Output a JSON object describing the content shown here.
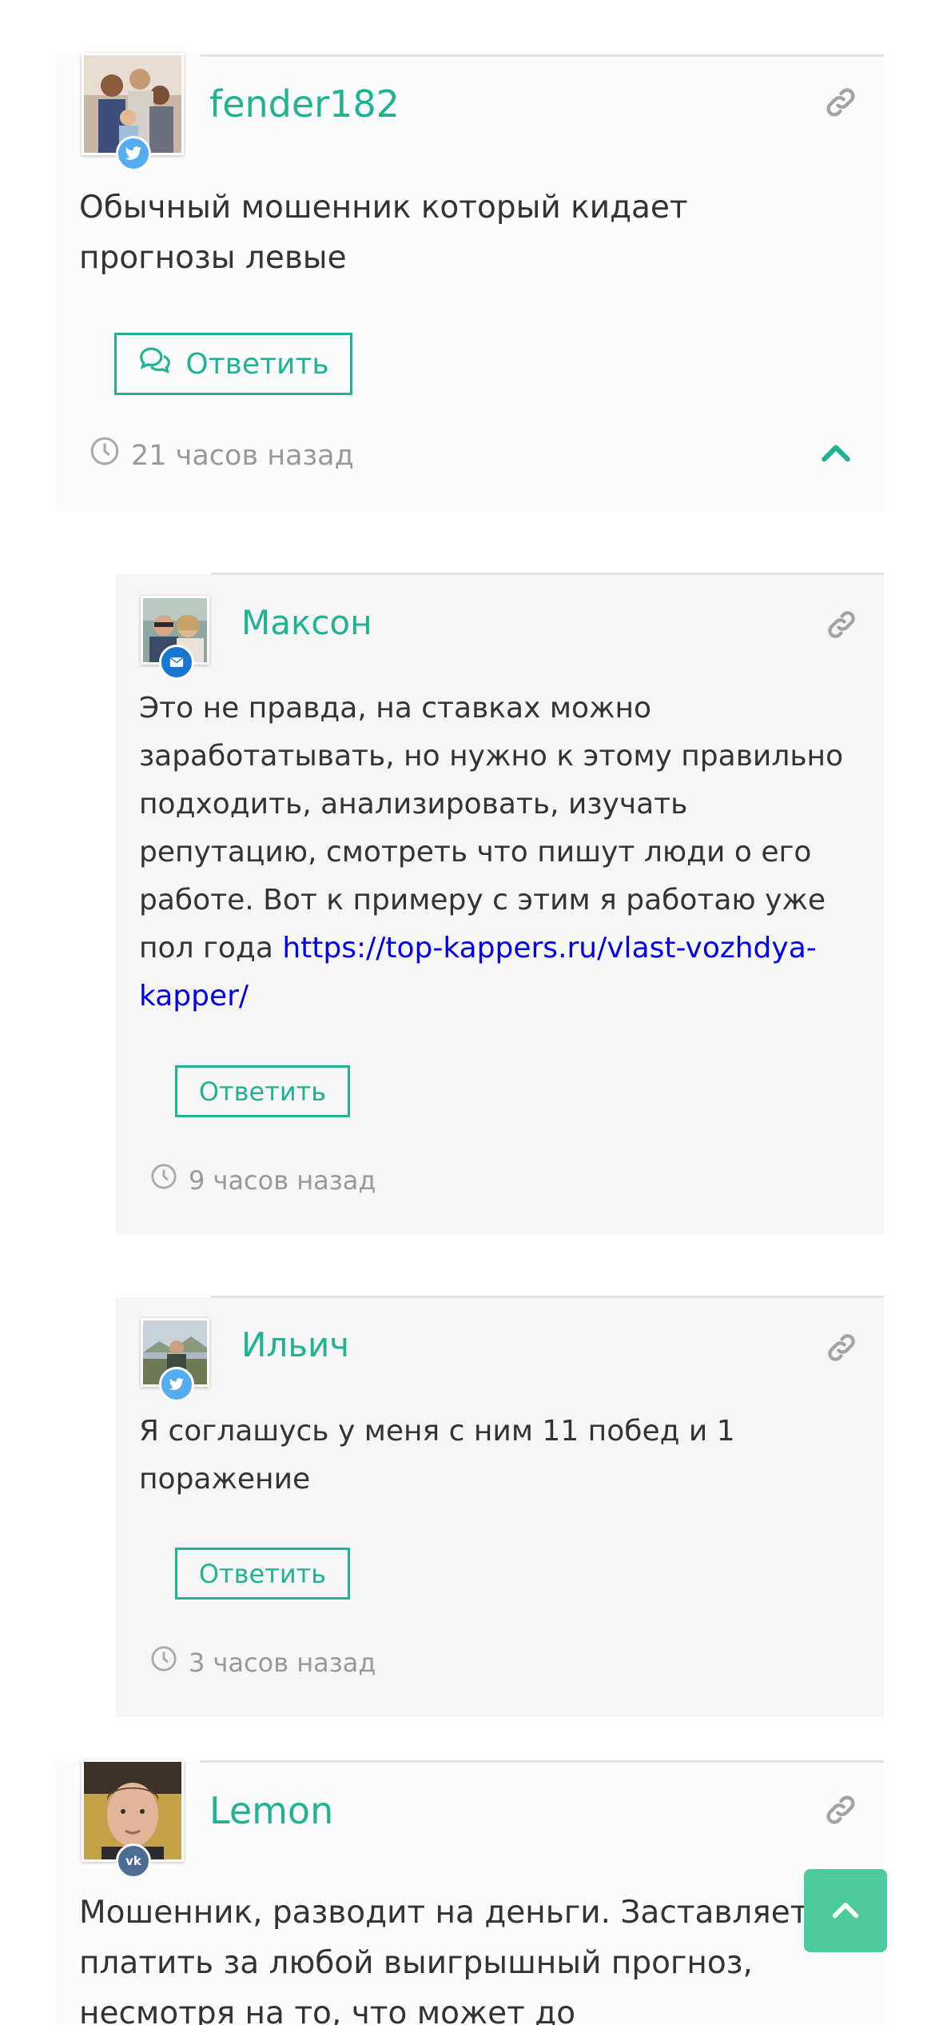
{
  "comments": [
    {
      "author": "fender182",
      "social": "twitter-icon",
      "text": "Обычный мошенник который кидает прогнозы левые",
      "reply_label": "Ответить",
      "time": "21 часов назад"
    },
    {
      "author": "Максон",
      "social": "email-icon",
      "text": "Это не правда, на ставках можно заработатывать, но нужно к этому правильно подходить, анализировать, изучать репутацию, смотреть что пишут люди о его работе. Вот к примеру с этим я работаю уже пол года ",
      "link": "https://top-kappers.ru/vlast-vozhdya-kapper/",
      "reply_label": "Ответить",
      "time": "9 часов назад"
    },
    {
      "author": "Ильич",
      "social": "twitter-icon",
      "text": "Я соглашусь у меня с ним 11 побед и 1 поражение",
      "reply_label": "Ответить",
      "time": "3 часов назад"
    },
    {
      "author": "Lemon",
      "social": "vk-icon",
      "text": "Мошенник, разводит на деньги. Заставляет платить за любой выигрышный прогноз, несмотря на то, что может до"
    }
  ],
  "colors": {
    "accent": "#1fb394",
    "link": "#0000ee",
    "muted": "#999999",
    "twitter": "#55acee",
    "email": "#1877d2",
    "vk": "#4c6c91",
    "scroll_button": "#4ecb9c"
  }
}
